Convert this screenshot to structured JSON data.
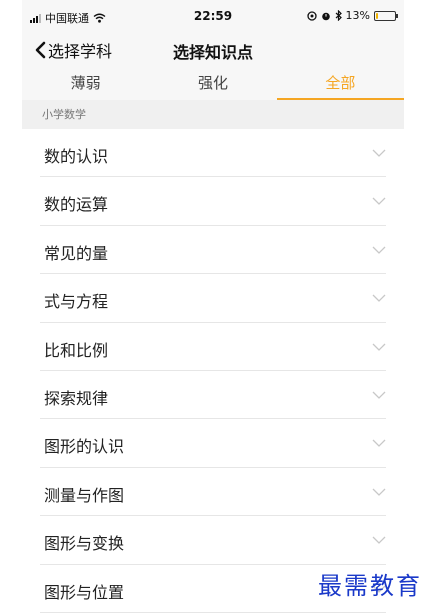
{
  "status": {
    "carrier": "中国联通",
    "time": "22:59",
    "battery": "13%",
    "battery_level": 0.13
  },
  "nav": {
    "back_label": "选择学科",
    "title": "选择知识点"
  },
  "tabs": [
    "薄弱",
    "强化",
    "全部"
  ],
  "active_tab": 2,
  "section_title": "小学数学",
  "topics": [
    "数的认识",
    "数的运算",
    "常见的量",
    "式与方程",
    "比和比例",
    "探索规律",
    "图形的认识",
    "测量与作图",
    "图形与变换",
    "图形与位置"
  ],
  "watermark": "最需教育",
  "colors": {
    "accent": "#f5a623",
    "watermark": "#1a39c9"
  }
}
